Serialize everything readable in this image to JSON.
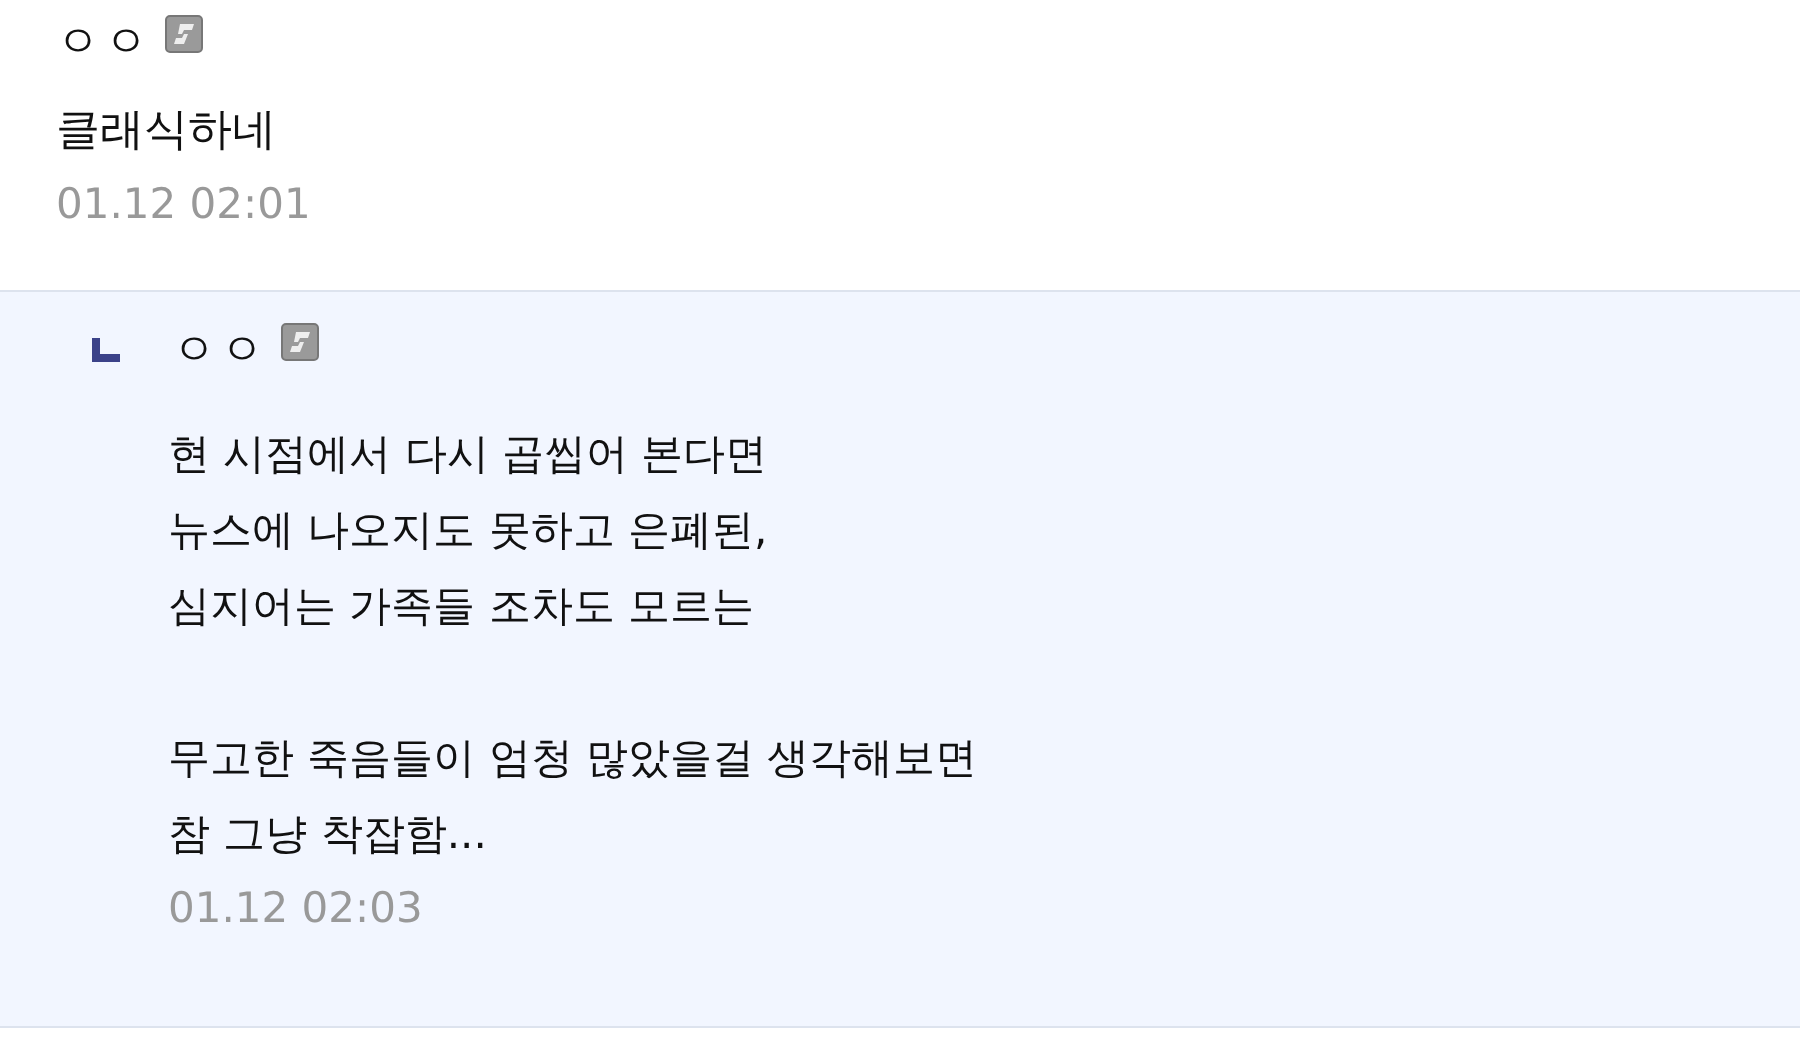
{
  "comment": {
    "author": "ㅇㅇ",
    "text": "클래식하네",
    "time": "01.12 02:01"
  },
  "reply": {
    "author": "ㅇㅇ",
    "text": "현 시점에서 다시 곱씹어 본다면\n뉴스에 나오지도 못하고 은폐된,\n심지어는 가족들 조차도 모르는\n\n무고한 죽음들이 엄청 많았을걸 생각해보면\n참 그냥 착잡함...",
    "time": "01.12 02:03"
  }
}
